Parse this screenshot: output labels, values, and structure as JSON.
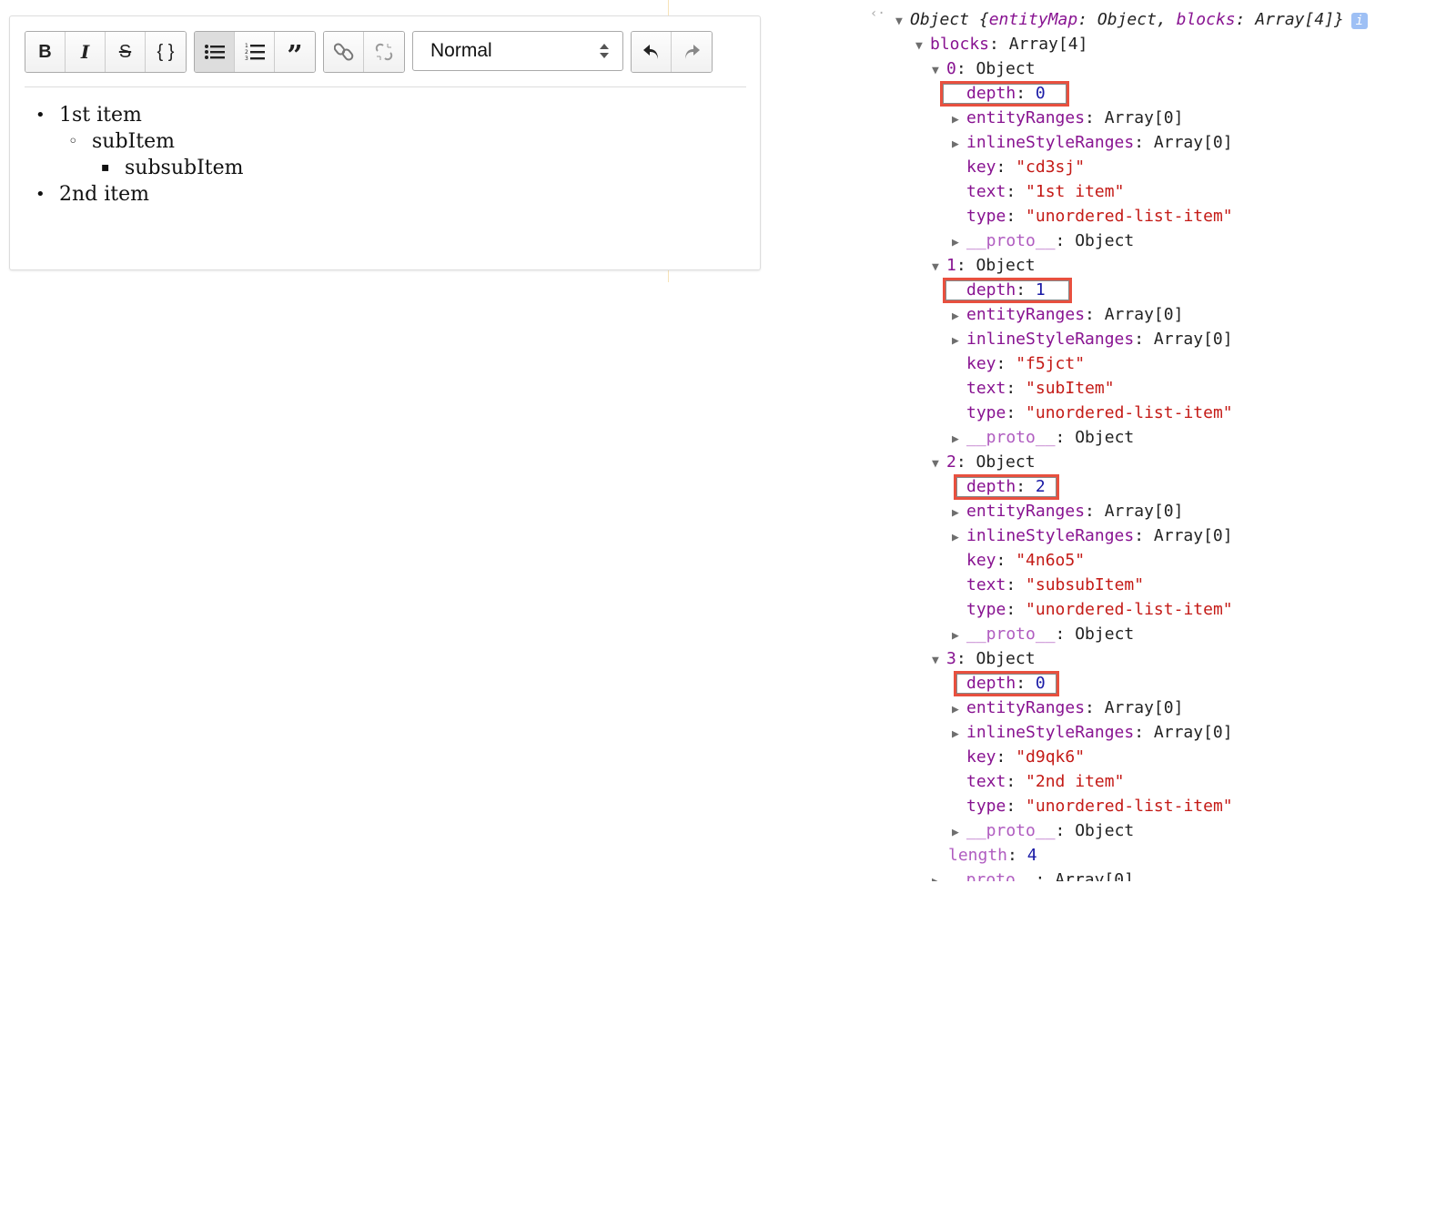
{
  "editor": {
    "toolbar": {
      "inline": [
        {
          "icon": "bold-icon",
          "label": "B"
        },
        {
          "icon": "italic-icon",
          "label": "I"
        },
        {
          "icon": "strikethrough-icon",
          "label": "S"
        },
        {
          "icon": "code-icon",
          "label": "{ }"
        }
      ],
      "block": [
        {
          "icon": "unordered-list-icon",
          "active": true
        },
        {
          "icon": "ordered-list-icon",
          "active": false
        },
        {
          "icon": "blockquote-icon",
          "active": false
        }
      ],
      "link": [
        {
          "icon": "link-icon"
        },
        {
          "icon": "unlink-icon"
        }
      ],
      "block_type": "Normal",
      "history": [
        {
          "icon": "undo-icon"
        },
        {
          "icon": "redo-icon"
        }
      ]
    },
    "items": [
      {
        "text": "1st item",
        "bullet": "•",
        "depth": 0
      },
      {
        "text": "subItem",
        "bullet": "◦",
        "depth": 1
      },
      {
        "text": "subsubItem",
        "bullet": "▪",
        "depth": 2
      },
      {
        "text": "2nd item",
        "bullet": "•",
        "depth": 0
      }
    ]
  },
  "console": {
    "root": {
      "prefix": "Object {",
      "k1": "entityMap",
      "v1": ": Object, ",
      "k2": "blocks",
      "v2": ": Array[4]}",
      "info": "i"
    },
    "blocks_label": "blocks",
    "blocks_value": ": Array[4]",
    "blocks": [
      {
        "index": "0",
        "key": "\"cd3sj\"",
        "text": "\"1st item\"",
        "type": "\"unordered-list-item\"",
        "depth": "0"
      },
      {
        "index": "1",
        "key": "\"f5jct\"",
        "text": "\"subItem\"",
        "type": "\"unordered-list-item\"",
        "depth": "1"
      },
      {
        "index": "2",
        "key": "\"4n6o5\"",
        "text": "\"subsubItem\"",
        "type": "\"unordered-list-item\"",
        "depth": "2"
      },
      {
        "index": "3",
        "key": "\"d9qk6\"",
        "text": "\"2nd item\"",
        "type": "\"unordered-list-item\"",
        "depth": "0"
      }
    ],
    "labels": {
      "object": ": Object",
      "depth": "depth",
      "entityRanges": "entityRanges",
      "inlineStyleRanges": "inlineStyleRanges",
      "array0": ": Array[0]",
      "key": "key",
      "text": "text",
      "type": "type",
      "proto": "__proto__",
      "length": "length",
      "colon": ": "
    },
    "length": "4",
    "highlight_color": "#e8503f"
  }
}
